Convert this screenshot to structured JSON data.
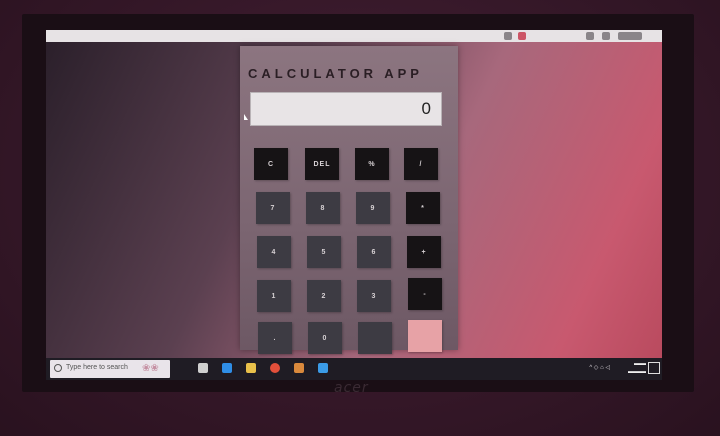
{
  "app": {
    "title": "CALCULATOR APP",
    "display_value": "0"
  },
  "keys": [
    [
      "C",
      "DEL",
      "%",
      "/"
    ],
    [
      "7",
      "8",
      "9",
      "*"
    ],
    [
      "4",
      "5",
      "6",
      "+"
    ],
    [
      "1",
      "2",
      "3",
      "-"
    ],
    [
      ".",
      "0",
      "",
      ""
    ]
  ],
  "taskbar": {
    "search_placeholder": "Type here to search"
  },
  "colors": {
    "equals": "#e7a2a6",
    "op_dark": "#161315",
    "digit": "#3d3b43"
  }
}
